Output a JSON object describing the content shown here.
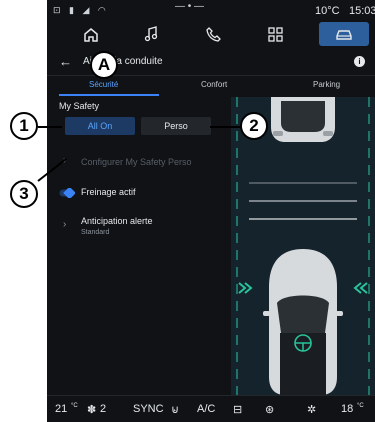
{
  "status": {
    "temperature": "10°C",
    "time": "15:03"
  },
  "header": {
    "title": "Aide à la conduite"
  },
  "tabs": [
    {
      "label": "Sécurité"
    },
    {
      "label": "Confort"
    },
    {
      "label": "Parking"
    }
  ],
  "section": {
    "label": "My Safety"
  },
  "modes": {
    "all_on": "All On",
    "perso": "Perso"
  },
  "menu": [
    {
      "label": "Configurer My Safety Perso",
      "sub": ""
    },
    {
      "label": "Freinage actif",
      "sub": ""
    },
    {
      "label": "Anticipation alerte",
      "sub": "Standard"
    }
  ],
  "bottombar": {
    "driver_temp": "21",
    "fan": "2",
    "sync": "SYNC",
    "ac": "A/C",
    "passenger_temp": "18"
  },
  "callouts": {
    "a": "A",
    "one": "1",
    "two": "2",
    "three": "3"
  },
  "colors": {
    "accent": "#3b82f6",
    "background": "#101215",
    "lane_green": "#29c39b"
  }
}
